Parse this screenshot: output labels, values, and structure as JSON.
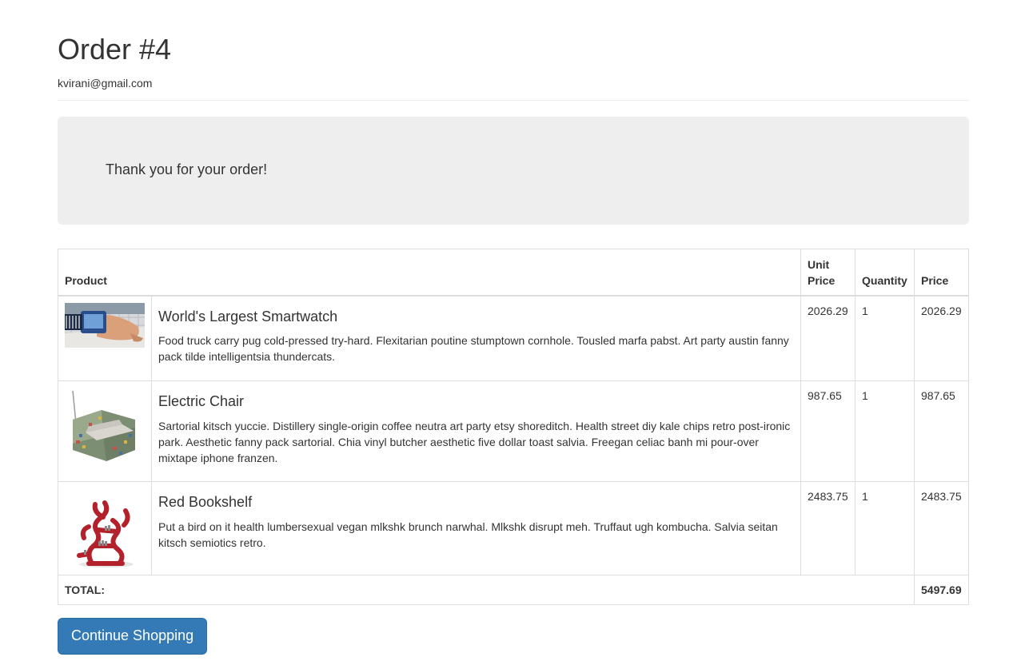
{
  "order": {
    "title": "Order #4",
    "email": "kvirani@gmail.com"
  },
  "jumbotron": {
    "message": "Thank you for your order!"
  },
  "table": {
    "headers": {
      "product": "Product",
      "unit_price": "Unit Price",
      "quantity": "Quantity",
      "price": "Price"
    },
    "rows": [
      {
        "name": "World's Largest Smartwatch",
        "description": "Food truck carry pug cold-pressed try-hard. Flexitarian poutine stumptown cornhole. Tousled marfa pabst. Art party austin fanny pack tilde intelligentsia thundercats.",
        "unit_price": "2026.29",
        "quantity": "1",
        "price": "2026.29"
      },
      {
        "name": "Electric Chair",
        "description": "Sartorial kitsch yuccie. Distillery single-origin coffee neutra art party etsy shoreditch. Health street diy kale chips retro post-ironic park. Aesthetic fanny pack sartorial. Chia vinyl butcher aesthetic five dollar toast salvia. Freegan celiac banh mi pour-over mixtape iphone franzen.",
        "unit_price": "987.65",
        "quantity": "1",
        "price": "987.65"
      },
      {
        "name": "Red Bookshelf",
        "description": "Put a bird on it health lumbersexual vegan mlkshk brunch narwhal. Mlkshk disrupt meh. Truffaut ugh kombucha. Salvia seitan kitsch semiotics retro.",
        "unit_price": "2483.75",
        "quantity": "1",
        "price": "2483.75"
      }
    ],
    "total_label": "TOTAL:",
    "total_value": "5497.69"
  },
  "actions": {
    "continue_label": "Continue Shopping"
  },
  "colors": {
    "primary": "#337ab7",
    "jumbotron_bg": "#eeeeee",
    "border": "#dddddd"
  }
}
